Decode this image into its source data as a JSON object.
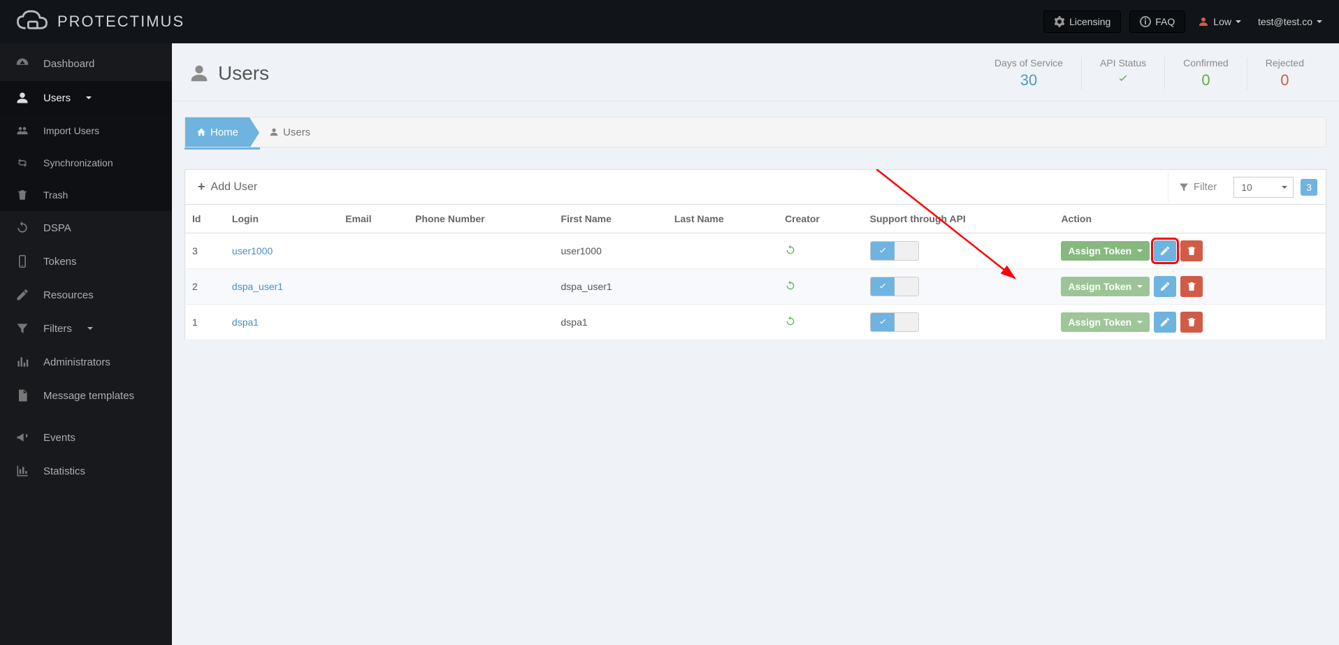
{
  "brand": "PROTECTIMUS",
  "topbar": {
    "licensing": "Licensing",
    "faq": "FAQ",
    "level": "Low",
    "email": "test@test.co"
  },
  "sidebar": {
    "dashboard": "Dashboard",
    "users": "Users",
    "import_users": "Import Users",
    "sync": "Synchronization",
    "trash": "Trash",
    "dspa": "DSPA",
    "tokens": "Tokens",
    "resources": "Resources",
    "filters": "Filters",
    "admins": "Administrators",
    "templates": "Message templates",
    "events": "Events",
    "statistics": "Statistics"
  },
  "page": {
    "title": "Users"
  },
  "stats": {
    "days_label": "Days of Service",
    "days_value": "30",
    "api_label": "API Status",
    "confirmed_label": "Confirmed",
    "confirmed_value": "0",
    "rejected_label": "Rejected",
    "rejected_value": "0"
  },
  "breadcrumb": {
    "home": "Home",
    "current": "Users"
  },
  "toolbar": {
    "add": "Add User",
    "filter": "Filter",
    "page_size": "10",
    "count": "3"
  },
  "table": {
    "headers": {
      "id": "Id",
      "login": "Login",
      "email": "Email",
      "phone": "Phone Number",
      "first": "First Name",
      "last": "Last Name",
      "creator": "Creator",
      "api": "Support through API",
      "action": "Action"
    },
    "rows": [
      {
        "id": "3",
        "login": "user1000",
        "email": "",
        "phone": "",
        "first": "user1000",
        "last": "",
        "assign": "Assign Token",
        "highlight": true
      },
      {
        "id": "2",
        "login": "dspa_user1",
        "email": "",
        "phone": "",
        "first": "dspa_user1",
        "last": "",
        "assign": "Assign Token",
        "highlight": false
      },
      {
        "id": "1",
        "login": "dspa1",
        "email": "",
        "phone": "",
        "first": "dspa1",
        "last": "",
        "assign": "Assign Token",
        "highlight": false
      }
    ]
  }
}
